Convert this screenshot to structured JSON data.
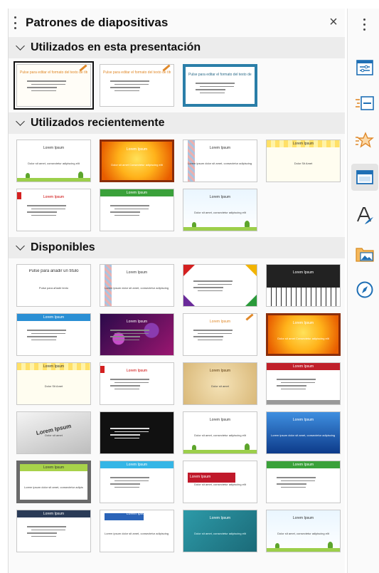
{
  "panel": {
    "title": "Patrones de diapositivas",
    "close_glyph": "×"
  },
  "sections": {
    "used": {
      "label": "Utilizados en esta presentación",
      "thumbs": [
        {
          "title": "Pulse para editar el formato del texto de título",
          "style": "pencil",
          "selected": true
        },
        {
          "title": "Pulse para editar el formato del texto de título",
          "style": "pencil-plain"
        },
        {
          "title": "Pulse para editar el formato del texto de título",
          "style": "blue-frame"
        }
      ]
    },
    "recent": {
      "label": "Utilizados recientemente",
      "thumbs": [
        {
          "title": "Lorem Ipsum",
          "body": "Dolor sit amet, consectetur adipiscing elit",
          "style": "green-hills"
        },
        {
          "title": "Lorem Ipsum",
          "body": "Dolor sit amet Consectetur adipiscing elit",
          "style": "orange-glow"
        },
        {
          "title": "Lorem Ipsum",
          "body": "Lorem ipsum dolor sit amet, consectetur adipiscing elit",
          "style": "diamond-strip"
        },
        {
          "title": "Lorem Ipsum",
          "body": "Dolor Sit Amet",
          "style": "yellow-dots"
        },
        {
          "title": "Lorem Ipsum",
          "style": "red-tab"
        },
        {
          "title": "Lorem Ipsum",
          "style": "green-bar"
        },
        {
          "title": "Lorem Ipsum",
          "body": "Dolor sit amet, consectetur adipiscing elit",
          "style": "clouds"
        }
      ]
    },
    "available": {
      "label": "Disponibles",
      "thumbs": [
        {
          "title": "Pulse para añadir un título",
          "body": "Pulse para añadir texto",
          "style": "plain-box"
        },
        {
          "title": "Lorem Ipsum",
          "body": "Lorem ipsum dolor sit amet, consectetur adipiscing elit",
          "style": "diamond-strip"
        },
        {
          "title": "",
          "style": "color-corners"
        },
        {
          "title": "Lorem Ipsum",
          "style": "piano"
        },
        {
          "title": "Lorem Ipsum",
          "style": "blue-top"
        },
        {
          "title": "Lorem Ipsum",
          "style": "bokeh"
        },
        {
          "title": "Lorem Ipsum",
          "style": "pencil-plain"
        },
        {
          "title": "Lorem Ipsum",
          "body": "Dolor sit amet Consectetur adipiscing elit",
          "style": "orange-glow"
        },
        {
          "title": "Lorem Ipsum",
          "body": "Dolor Sit Amet",
          "style": "yellow-dots"
        },
        {
          "title": "Lorem Ipsum",
          "style": "red-tab"
        },
        {
          "title": "Lorem Ipsum",
          "body": "Dolor sit amet",
          "style": "parchment"
        },
        {
          "title": "Lorem Ipsum",
          "style": "red-stripes"
        },
        {
          "title": "Lorem Ipsum",
          "body": "Dolor sit amet",
          "style": "grey-tilt"
        },
        {
          "title": "",
          "style": "black-list"
        },
        {
          "title": "Lorem Ipsum",
          "body": "Dolor sit amet, consectetur adipiscing elit",
          "style": "green-hills"
        },
        {
          "title": "Lorem Ipsum",
          "body": "Lorem ipsum dolor sit amet, consectetur adipiscing elit",
          "style": "blue-grad"
        },
        {
          "title": "Lorem Ipsum",
          "body": "Lorem ipsum dolor sit amet, consectetur adipiscing elit",
          "style": "green-frame"
        },
        {
          "title": "Lorem Ipsum",
          "style": "cyan-top"
        },
        {
          "title": "Lorem Ipsum",
          "body": "Dolor sit amet, consectetur adipiscing elit",
          "style": "red-band"
        },
        {
          "title": "Lorem Ipsum",
          "style": "green-bar"
        },
        {
          "title": "Lorem Ipsum",
          "style": "navy-top"
        },
        {
          "title": "Lorem Ipsum",
          "body": "Lorem ipsum dolor sit amet, consectetur adipiscing elit",
          "style": "blue-label"
        },
        {
          "title": "Lorem Ipsum",
          "body": "Dolor sit amet, consectetur adipiscing elit",
          "style": "teal-chalk"
        },
        {
          "title": "Lorem Ipsum",
          "body": "Dolor sit amet, consectetur adipiscing elit",
          "style": "clouds"
        }
      ]
    }
  },
  "sidebar": {
    "items": [
      {
        "icon": "properties-icon"
      },
      {
        "icon": "slide-transition-icon"
      },
      {
        "icon": "animation-icon"
      },
      {
        "icon": "master-slides-icon",
        "active": true
      },
      {
        "icon": "styles-icon"
      },
      {
        "icon": "gallery-icon"
      },
      {
        "icon": "navigator-icon"
      }
    ]
  }
}
